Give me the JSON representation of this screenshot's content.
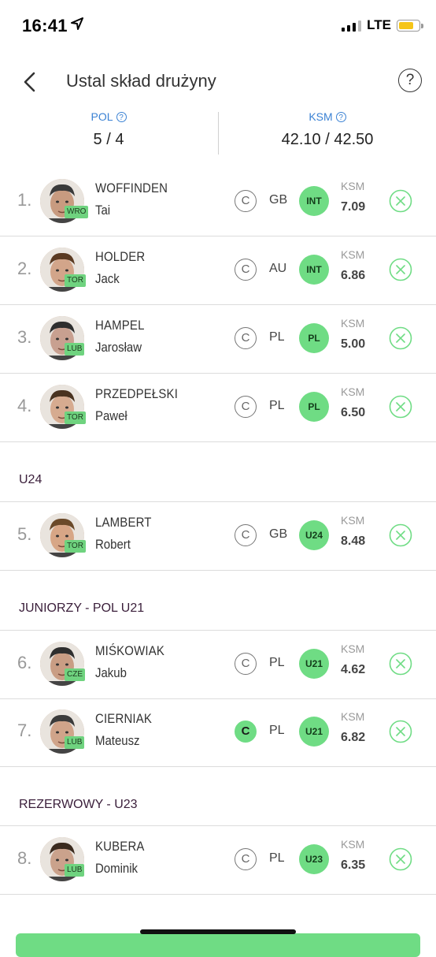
{
  "status": {
    "time": "16:41",
    "network": "LTE"
  },
  "header": {
    "title": "Ustal skład drużyny",
    "help": "?"
  },
  "summary": {
    "pol": {
      "label": "POL",
      "value": "5 / 4"
    },
    "ksm": {
      "label": "KSM",
      "value": "42.10 / 42.50"
    }
  },
  "common": {
    "ksm_label": "KSM",
    "captain_label": "C"
  },
  "sections": {
    "u24": "U24",
    "juniors": "JUNIORZY - POL U21",
    "reserve": "REZERWOWY - U23"
  },
  "players": [
    {
      "num": "1.",
      "surname": "WOFFINDEN",
      "firstname": "Tai",
      "team": "WRO",
      "country": "GB",
      "category": "INT",
      "ksm": "7.09",
      "captain": false
    },
    {
      "num": "2.",
      "surname": "HOLDER",
      "firstname": "Jack",
      "team": "TOR",
      "country": "AU",
      "category": "INT",
      "ksm": "6.86",
      "captain": false
    },
    {
      "num": "3.",
      "surname": "HAMPEL",
      "firstname": "Jarosław",
      "team": "LUB",
      "country": "PL",
      "category": "PL",
      "ksm": "5.00",
      "captain": false
    },
    {
      "num": "4.",
      "surname": "PRZEDPEŁSKI",
      "firstname": "Paweł",
      "team": "TOR",
      "country": "PL",
      "category": "PL",
      "ksm": "6.50",
      "captain": false
    },
    {
      "num": "5.",
      "surname": "LAMBERT",
      "firstname": "Robert",
      "team": "TOR",
      "country": "GB",
      "category": "U24",
      "ksm": "8.48",
      "captain": false
    },
    {
      "num": "6.",
      "surname": "MIŚKOWIAK",
      "firstname": "Jakub",
      "team": "CZE",
      "country": "PL",
      "category": "U21",
      "ksm": "4.62",
      "captain": false
    },
    {
      "num": "7.",
      "surname": "CIERNIAK",
      "firstname": "Mateusz",
      "team": "LUB",
      "country": "PL",
      "category": "U21",
      "ksm": "6.82",
      "captain": true
    },
    {
      "num": "8.",
      "surname": "KUBERA",
      "firstname": "Dominik",
      "team": "LUB",
      "country": "PL",
      "category": "U23",
      "ksm": "6.35",
      "captain": false
    }
  ],
  "colors": {
    "accent_green": "#6fdc84",
    "link_blue": "#3b82d4",
    "section_text": "#3a1e3a"
  }
}
